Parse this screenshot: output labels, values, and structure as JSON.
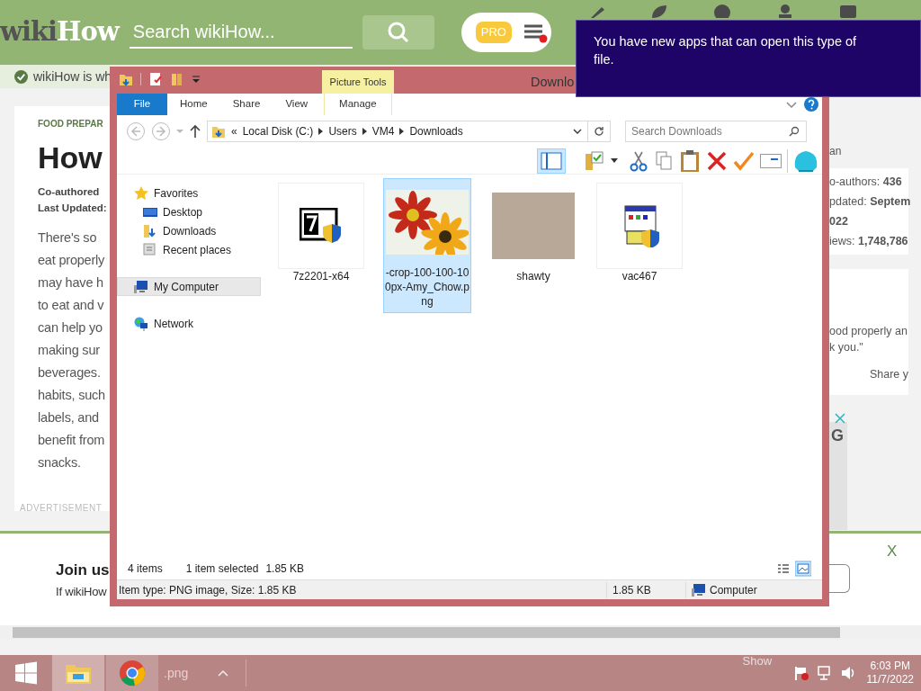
{
  "browser": {
    "logo": {
      "first": "wiki",
      "second": "How"
    },
    "search": {
      "placeholder": "Search wikiHow..."
    },
    "pro_badge": "PRO",
    "menu_alert": true,
    "notice": "wikiHow is wh"
  },
  "article": {
    "category": "FOOD PREPAR",
    "title": "How",
    "coauthored": "Co-authored",
    "updated": "Last Updated:",
    "body": [
      "There's so",
      "eat properly",
      "may have h",
      "to eat and v",
      "can help yo",
      "making sur",
      "beverages.",
      "habits, such",
      "labels, and",
      "benefit from",
      "snacks."
    ],
    "ad_label": "ADVERTISEMENT"
  },
  "sidebar": {
    "author": "an",
    "stats": [
      "o-authors: **436**",
      "pdated: **Septem**",
      "**022**",
      "iews: **1,748,786**"
    ],
    "quote": [
      "ood properly an",
      "k you.\""
    ],
    "share": "Share y",
    "ad_text": "G"
  },
  "join_banner": {
    "title": "Join us",
    "text": "If wikiHow",
    "close": "X"
  },
  "explorer": {
    "title": "Downlo",
    "context_group": "Picture Tools",
    "tabs": [
      {
        "label": "File",
        "kind": "file"
      },
      {
        "label": "Home",
        "kind": "plain"
      },
      {
        "label": "Share",
        "kind": "plain"
      },
      {
        "label": "View",
        "kind": "plain"
      },
      {
        "label": "Manage",
        "kind": "contextual"
      }
    ],
    "path_overflow": "«",
    "path": [
      "Local Disk (C:)",
      "Users",
      "VM4",
      "Downloads"
    ],
    "search": {
      "placeholder": "Search Downloads"
    },
    "navigation": [
      {
        "label": "Favorites",
        "kind": "star",
        "selected": false,
        "children": [
          {
            "label": "Desktop",
            "kind": "desktop",
            "selected": false
          },
          {
            "label": "Downloads",
            "kind": "downloads",
            "selected": false
          },
          {
            "label": "Recent places",
            "kind": "recent",
            "selected": false
          }
        ]
      },
      {
        "label": "My Computer",
        "kind": "computer",
        "selected": true
      },
      {
        "label": "Network",
        "kind": "network",
        "selected": false
      }
    ],
    "files": [
      {
        "name": "7z2201-x64",
        "kind": "installer",
        "selected": false
      },
      {
        "name": "-crop-100-100-100px-Amy_Chow.png",
        "kind": "image",
        "selected": true
      },
      {
        "name": "shawty",
        "kind": "photo",
        "selected": false
      },
      {
        "name": "vac467",
        "kind": "app",
        "selected": false
      }
    ],
    "status": {
      "count": "4 items",
      "selection": "1 item selected",
      "selection_size": "1.85 KB"
    },
    "views": [
      {
        "kind": "details",
        "selected": false
      },
      {
        "kind": "large_icons",
        "selected": true
      }
    ],
    "details": {
      "info": "Item type: PNG image, Size: 1.85 KB",
      "size": "1.85 KB",
      "location": "Computer"
    }
  },
  "notification": {
    "text": "You have new apps that can open this type of file."
  },
  "taskbar": {
    "buttons": [
      {
        "kind": "explorer"
      },
      {
        "kind": "chrome"
      }
    ],
    "ghost_label": ".png",
    "show_fragment": "Show",
    "time": "6:03 PM",
    "date": "11/7/2022"
  }
}
